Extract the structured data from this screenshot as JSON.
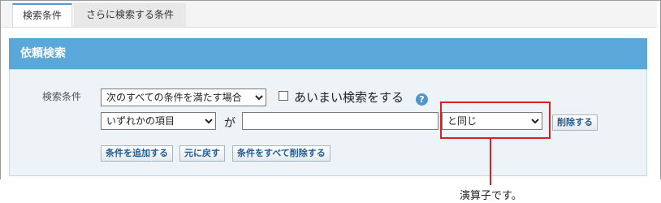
{
  "tabs": [
    {
      "label": "検索条件"
    },
    {
      "label": "さらに検索する条件"
    }
  ],
  "panel": {
    "title": "依頼検索"
  },
  "search": {
    "condition_label": "検索条件",
    "match_select": {
      "value": "次のすべての条件を満たす場合"
    },
    "fuzzy_label": "あいまい検索をする",
    "help_glyph": "?",
    "field_select": {
      "value": "いずれかの項目"
    },
    "ga_label": "が",
    "value_input": "",
    "operator_select": {
      "value": "と同じ"
    },
    "delete_row_label": "削除する",
    "add_condition_label": "条件を追加する",
    "restore_label": "元に戻す",
    "delete_all_label": "条件をすべて削除する"
  },
  "annotation": {
    "text": "演算子です。"
  },
  "colors": {
    "header": "#5aa7d9",
    "highlight": "#e02020",
    "button_text": "#1f5d93"
  }
}
